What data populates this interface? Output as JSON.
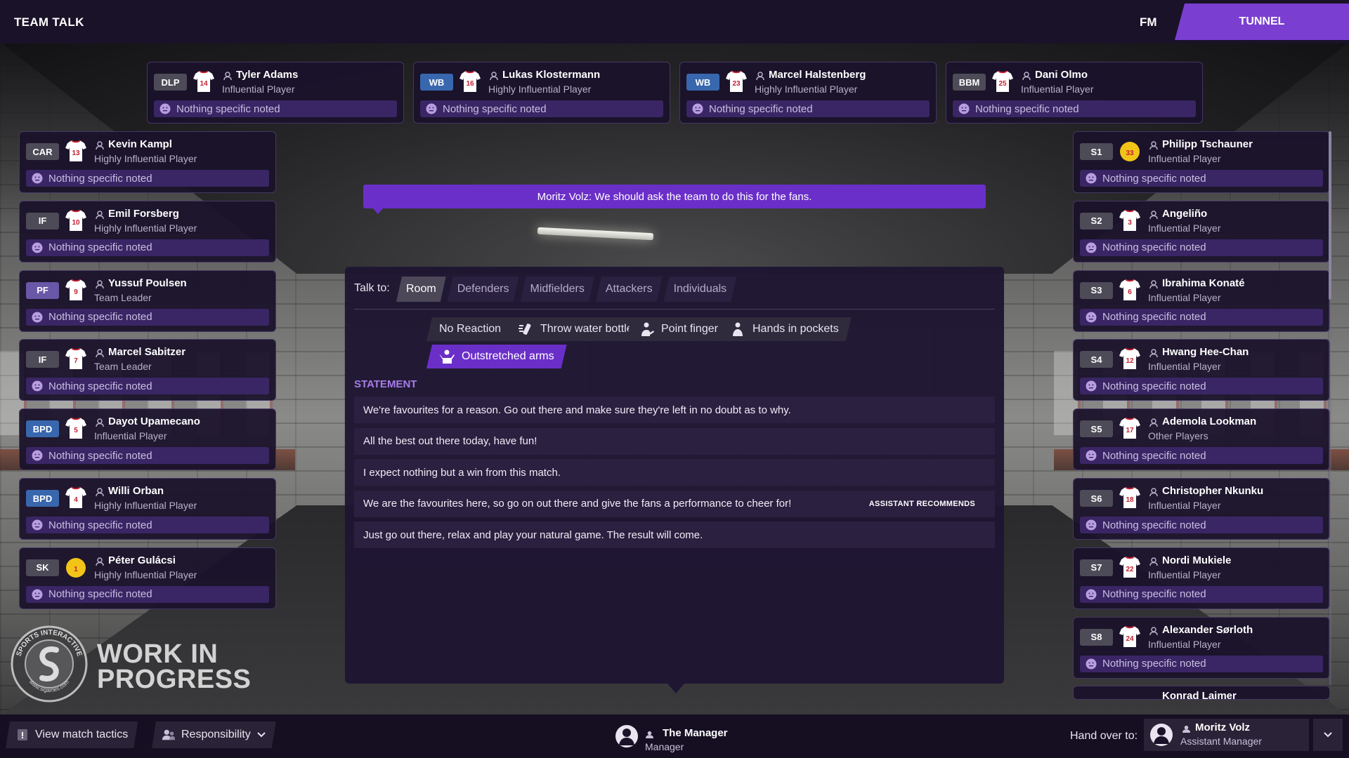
{
  "header": {
    "title": "TEAM TALK",
    "logo": "FM",
    "tunnel_button": "TUNNEL"
  },
  "assistant_banner": "Moritz Volz: We should ask the team to do this for the fans.",
  "default_mood": "Nothing specific noted",
  "top_players": [
    {
      "pos": "DLP",
      "pos_color": "grey",
      "number": "14",
      "name": "Tyler Adams",
      "role": "Influential Player",
      "mood": "Nothing specific noted"
    },
    {
      "pos": "WB",
      "pos_color": "blue",
      "number": "16",
      "name": "Lukas Klostermann",
      "role": "Highly Influential Player",
      "mood": "Nothing specific noted"
    },
    {
      "pos": "WB",
      "pos_color": "blue",
      "number": "23",
      "name": "Marcel Halstenberg",
      "role": "Highly Influential Player",
      "mood": "Nothing specific noted"
    },
    {
      "pos": "BBM",
      "pos_color": "grey",
      "number": "25",
      "name": "Dani Olmo",
      "role": "Influential Player",
      "mood": "Nothing specific noted"
    }
  ],
  "left_players": [
    {
      "pos": "CAR",
      "pos_color": "grey",
      "number": "13",
      "name": "Kevin Kampl",
      "role": "Highly Influential Player",
      "mood": "Nothing specific noted"
    },
    {
      "pos": "IF",
      "pos_color": "grey",
      "number": "10",
      "name": "Emil Forsberg",
      "role": "Highly Influential Player",
      "mood": "Nothing specific noted"
    },
    {
      "pos": "PF",
      "pos_color": "purple",
      "number": "9",
      "name": "Yussuf Poulsen",
      "role": "Team Leader",
      "mood": "Nothing specific noted"
    },
    {
      "pos": "IF",
      "pos_color": "grey",
      "number": "7",
      "name": "Marcel Sabitzer",
      "role": "Team Leader",
      "mood": "Nothing specific noted"
    },
    {
      "pos": "BPD",
      "pos_color": "blue",
      "number": "5",
      "name": "Dayot Upamecano",
      "role": "Influential Player",
      "mood": "Nothing specific noted"
    },
    {
      "pos": "BPD",
      "pos_color": "blue",
      "number": "4",
      "name": "Willi Orban",
      "role": "Highly Influential Player",
      "mood": "Nothing specific noted"
    },
    {
      "pos": "SK",
      "pos_color": "grey",
      "number": "1",
      "name": "Péter Gulácsi",
      "role": "Highly Influential Player",
      "mood": "Nothing specific noted",
      "keeper": true
    }
  ],
  "right_players": [
    {
      "pos": "S1",
      "pos_color": "grey",
      "number": "33",
      "name": "Philipp Tschauner",
      "role": "Influential Player",
      "mood": "Nothing specific noted",
      "keeper": true
    },
    {
      "pos": "S2",
      "pos_color": "grey",
      "number": "3",
      "name": "Angeliño",
      "role": "Influential Player",
      "mood": "Nothing specific noted"
    },
    {
      "pos": "S3",
      "pos_color": "grey",
      "number": "6",
      "name": "Ibrahima Konaté",
      "role": "Influential Player",
      "mood": "Nothing specific noted"
    },
    {
      "pos": "S4",
      "pos_color": "grey",
      "number": "12",
      "name": "Hwang Hee-Chan",
      "role": "Influential Player",
      "mood": "Nothing specific noted"
    },
    {
      "pos": "S5",
      "pos_color": "grey",
      "number": "17",
      "name": "Ademola Lookman",
      "role": "Other Players",
      "mood": "Nothing specific noted"
    },
    {
      "pos": "S6",
      "pos_color": "grey",
      "number": "18",
      "name": "Christopher Nkunku",
      "role": "Influential Player",
      "mood": "Nothing specific noted"
    },
    {
      "pos": "S7",
      "pos_color": "grey",
      "number": "22",
      "name": "Nordi Mukiele",
      "role": "Influential Player",
      "mood": "Nothing specific noted"
    },
    {
      "pos": "S8",
      "pos_color": "grey",
      "number": "24",
      "name": "Alexander Sørloth",
      "role": "Influential Player",
      "mood": "Nothing specific noted"
    },
    {
      "pos": "",
      "pos_color": "grey",
      "number": "",
      "name": "Konrad Laimer",
      "role": "",
      "mood": "",
      "partial": true
    }
  ],
  "talk": {
    "label": "Talk to:",
    "tabs": [
      {
        "label": "Room",
        "active": true
      },
      {
        "label": "Defenders",
        "active": false
      },
      {
        "label": "Midfielders",
        "active": false
      },
      {
        "label": "Attackers",
        "active": false
      },
      {
        "label": "Individuals",
        "active": false
      }
    ],
    "gestures": [
      {
        "label": "No Reaction",
        "icon": "",
        "selected": false
      },
      {
        "label": "Throw water bottle",
        "icon": "throw-bottle-icon",
        "selected": false
      },
      {
        "label": "Point finger",
        "icon": "point-finger-icon",
        "selected": false
      },
      {
        "label": "Hands in pockets",
        "icon": "hands-pockets-icon",
        "selected": false
      },
      {
        "label": "Outstretched arms",
        "icon": "outstretched-arms-icon",
        "selected": true
      }
    ],
    "statement_heading": "STATEMENT",
    "statements": [
      {
        "text": "We're favourites for a reason. Go out there and make sure they're left in no doubt as to why.",
        "badge": ""
      },
      {
        "text": "All the best out there today, have fun!",
        "badge": ""
      },
      {
        "text": "I expect nothing but a win from this match.",
        "badge": ""
      },
      {
        "text": "We are the favourites here, so go on out there and give the fans a performance to cheer for!",
        "badge": "ASSISTANT RECOMMENDS"
      },
      {
        "text": "Just go out there, relax and play your natural game. The result will come.",
        "badge": ""
      }
    ]
  },
  "watermark": {
    "line1": "WORK IN",
    "line2": "PROGRESS",
    "logo_text": "SPORTS INTERACTIVE",
    "logo_sub": "www.sigames.com"
  },
  "footer": {
    "view_tactics": "View match tactics",
    "responsibility": "Responsibility",
    "manager_name": "The Manager",
    "manager_role": "Manager",
    "handover_label": "Hand over to:",
    "handover_name": "Moritz Volz",
    "handover_role": "Assistant Manager"
  },
  "colors": {
    "accent": "#6b2fc9",
    "tunnel": "#7a3fd0",
    "mood_bg": "#3a2565",
    "pos_grey": "#4d4b57",
    "pos_blue": "#3867ae",
    "pos_purple": "#6957a8",
    "keeper_yellow": "#f2c418"
  }
}
